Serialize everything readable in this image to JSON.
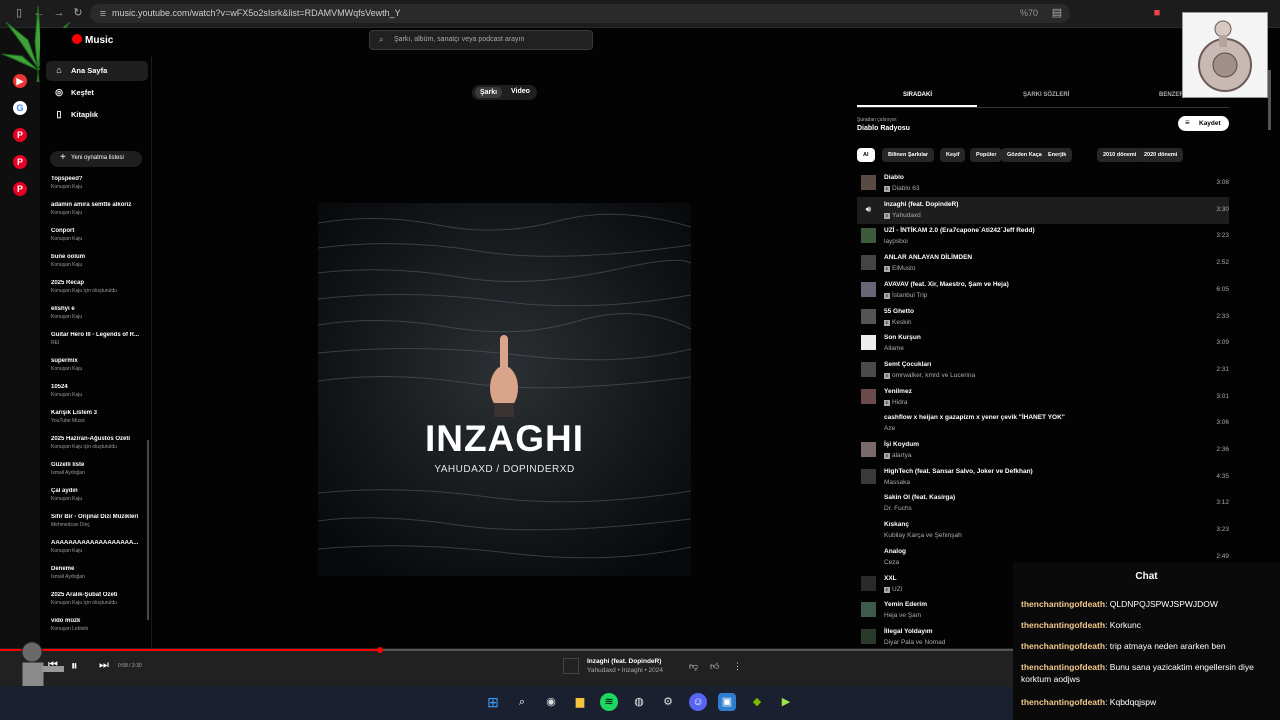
{
  "browser": {
    "url": "music.youtube.com/watch?v=wFX5o2sIsrk&list=RDAMVMWqfsVewth_Y",
    "zoom": "%70"
  },
  "header": {
    "logo_text": "Music",
    "search_placeholder": "Şarkı, albüm, sanatçı veya podcast arayın"
  },
  "sidebar": {
    "nav": [
      {
        "label": "Ana Sayfa",
        "icon": "home-icon"
      },
      {
        "label": "Keşfet",
        "icon": "compass-icon"
      },
      {
        "label": "Kitaplık",
        "icon": "library-icon"
      }
    ],
    "new_playlist": "Yeni oynatma listesi",
    "playlists": [
      {
        "title": "Topspeed?",
        "sub": "Konuşan Kaju"
      },
      {
        "title": "adamın amıra semtte alkoriz",
        "sub": "Konuşan Kaju"
      },
      {
        "title": "Conport",
        "sub": "Konuşan Kaju"
      },
      {
        "title": "bune oolum",
        "sub": "Konuşan Kaju"
      },
      {
        "title": "2025 Recap",
        "sub": "Konuşan Kaju için oluşturuldu"
      },
      {
        "title": "elishyı e",
        "sub": "Konuşan Kaju"
      },
      {
        "title": "Guitar Hero III - Legends of R...",
        "sub": "REI"
      },
      {
        "title": "supermix",
        "sub": "Konuşan Kaju"
      },
      {
        "title": "10524",
        "sub": "Konuşan Kaju"
      },
      {
        "title": "Karışık Listem 3",
        "sub": "YouTube Music"
      },
      {
        "title": "2025 Haziran-Ağustos Özeti",
        "sub": "Konuşan Kaju için oluşturuldu"
      },
      {
        "title": "Güzelli liste",
        "sub": "İsmail Aydoğan"
      },
      {
        "title": "Çal aydın",
        "sub": "Konuşan Kaju"
      },
      {
        "title": "Sıfır Bir - Orijinal Dizi Müzikleri",
        "sub": "Mehmedcan Dinç"
      },
      {
        "title": "AAAAAAAAAAAAAAAAAAA...",
        "sub": "Konuşan Kaju"
      },
      {
        "title": "Deneme",
        "sub": "İsmail Aydoğan"
      },
      {
        "title": "2025 Aralık-Şubat Özeti",
        "sub": "Konuşan Kaju için oluşturuldu"
      },
      {
        "title": "vido müzk",
        "sub": "Konuşan Leblebi"
      }
    ]
  },
  "main": {
    "toggle": {
      "song": "Şarkı",
      "video": "Video"
    },
    "art_title": "INZAGHI",
    "art_subtitle": "YAHUDAXD / DOPINDERXD"
  },
  "queue": {
    "tabs": [
      "SIRADAKİ",
      "ŞARKI SÖZLERİ",
      "BENZER"
    ],
    "playing_from_label": "Şuradan çalınıyor:",
    "playing_from": "Diablo Radyosu",
    "save": "Kaydet",
    "chips": [
      "Al",
      "Bilinen Şarkılar",
      "Keşif",
      "Popüler",
      "Gözden Kaçanlar",
      "Enerjik",
      "2010 dönemi",
      "2020 dönemi"
    ],
    "songs": [
      {
        "title": "Diablo",
        "artist": "Diablo 63",
        "duration": "3:08",
        "explicit": true
      },
      {
        "title": "Inzaghi (feat. DopindeR)",
        "artist": "Yahudaxd",
        "duration": "3:30",
        "explicit": true,
        "current": true
      },
      {
        "title": "UZİ - İNTİKAM 2.0 (Era7capone´Ati242´Jeff Redd)",
        "artist": "laypsboi",
        "duration": "3:23",
        "explicit": false
      },
      {
        "title": "ANLAR ANLAYAN DİLİMDEN",
        "artist": "ElMusto",
        "duration": "2:52",
        "explicit": true
      },
      {
        "title": "AVAVAV (feat. Xir, Maestro, Şam ve Heja)",
        "artist": "İstanbul Trip",
        "duration": "6:05",
        "explicit": true
      },
      {
        "title": "55 Ghetto",
        "artist": "Keskin",
        "duration": "2:33",
        "explicit": true
      },
      {
        "title": "Son Kurşun",
        "artist": "Allame",
        "duration": "3:09",
        "explicit": false
      },
      {
        "title": "Semt Çocukları",
        "artist": "omrwalker, kmrd ve Lucerina",
        "duration": "2:31",
        "explicit": true
      },
      {
        "title": "Yenilmez",
        "artist": "Hidra",
        "duration": "3:01",
        "explicit": true
      },
      {
        "title": "cashflow x heijan x gazapizm x yener çevik \"İHANET YOK\"",
        "artist": "Aze",
        "duration": "3:06",
        "explicit": false
      },
      {
        "title": "İşi Koydum",
        "artist": "alartya",
        "duration": "2:36",
        "explicit": true
      },
      {
        "title": "HighTech (feat. Sansar Salvo, Joker ve Defkhan)",
        "artist": "Massaka",
        "duration": "4:35",
        "explicit": false
      },
      {
        "title": "Sakin Ol (feat. Kasirga)",
        "artist": "Dr. Fuchs",
        "duration": "3:12",
        "explicit": false
      },
      {
        "title": "Kıskanç",
        "artist": "Kubilay Karça ve Şehinşah",
        "duration": "3:23",
        "explicit": false
      },
      {
        "title": "Analog",
        "artist": "Ceza",
        "duration": "2:49",
        "explicit": false
      },
      {
        "title": "XXL",
        "artist": "UZI",
        "duration": "",
        "explicit": true
      },
      {
        "title": "Yemin Ederim",
        "artist": "Heja ve Şam",
        "duration": "",
        "explicit": false
      },
      {
        "title": "İllegal Yoldayım",
        "artist": "Diyar Pala ve Nomad",
        "duration": "",
        "explicit": false
      }
    ]
  },
  "player": {
    "time": "0:58 / 3:30",
    "progress": 0.297,
    "title": "Inzaghi (feat. DopindeR)",
    "subtitle": "Yahudaxd • Inzaghi • 2024"
  },
  "chat": {
    "title": "Chat",
    "messages": [
      {
        "user": "thenchantingofdeath",
        "text": "QLDNPQJSPWJSPWJDOW"
      },
      {
        "user": "thenchantingofdeath",
        "text": "Korkunc"
      },
      {
        "user": "thenchantingofdeath",
        "text": "trip atmaya neden ararken ben"
      },
      {
        "user": "thenchantingofdeath",
        "text": "Bunu sana yazicaktim engellersin diye korktum aodjws"
      },
      {
        "user": "thenchantingofdeath",
        "text": "Kqbdqqjspw"
      }
    ]
  },
  "colors": {
    "accent": "#ff0000",
    "chat_user": "#f3c98b",
    "taskbar": "#1b2030"
  }
}
